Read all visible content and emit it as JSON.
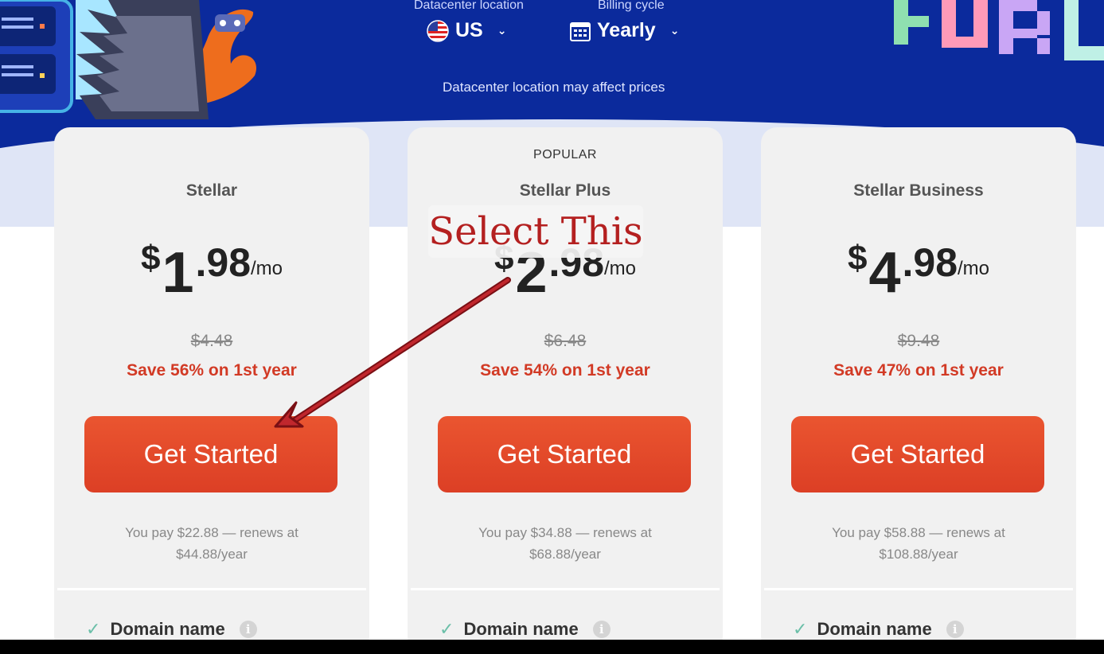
{
  "selectors": {
    "location": {
      "label": "Datacenter location",
      "value": "US",
      "icon": "us-flag-icon"
    },
    "billing": {
      "label": "Billing cycle",
      "value": "Yearly",
      "icon": "calendar-icon"
    },
    "note": "Datacenter location may affect prices"
  },
  "plans": [
    {
      "badge": "",
      "name": "Stellar",
      "currency": "$",
      "dollars": "1",
      "cents": ".98",
      "period": "/mo",
      "old_price": "$4.48",
      "save": "Save 56% on 1st year",
      "cta": "Get Started",
      "renew_line1": "You pay $22.88 — renews at",
      "renew_line2": "$44.88/year",
      "feature": "Domain name"
    },
    {
      "badge": "POPULAR",
      "name": "Stellar Plus",
      "currency": "$",
      "dollars": "2",
      "cents": ".98",
      "period": "/mo",
      "old_price": "$6.48",
      "save": "Save 54% on 1st year",
      "cta": "Get Started",
      "renew_line1": "You pay $34.88 — renews at",
      "renew_line2": "$68.88/year",
      "feature": "Domain name"
    },
    {
      "badge": "",
      "name": "Stellar Business",
      "currency": "$",
      "dollars": "4",
      "cents": ".98",
      "period": "/mo",
      "old_price": "$9.48",
      "save": "Save 47% on 1st year",
      "cta": "Get Started",
      "renew_line1": "You pay $58.88 — renews at",
      "renew_line2": "$108.88/year",
      "feature": "Domain name"
    }
  ],
  "annotation": {
    "text": "Select This",
    "color": "#b42020"
  },
  "colors": {
    "hero": "#0b2a9c",
    "cta": "#e4492b",
    "save": "#d23a25",
    "check": "#6bbfa8"
  }
}
